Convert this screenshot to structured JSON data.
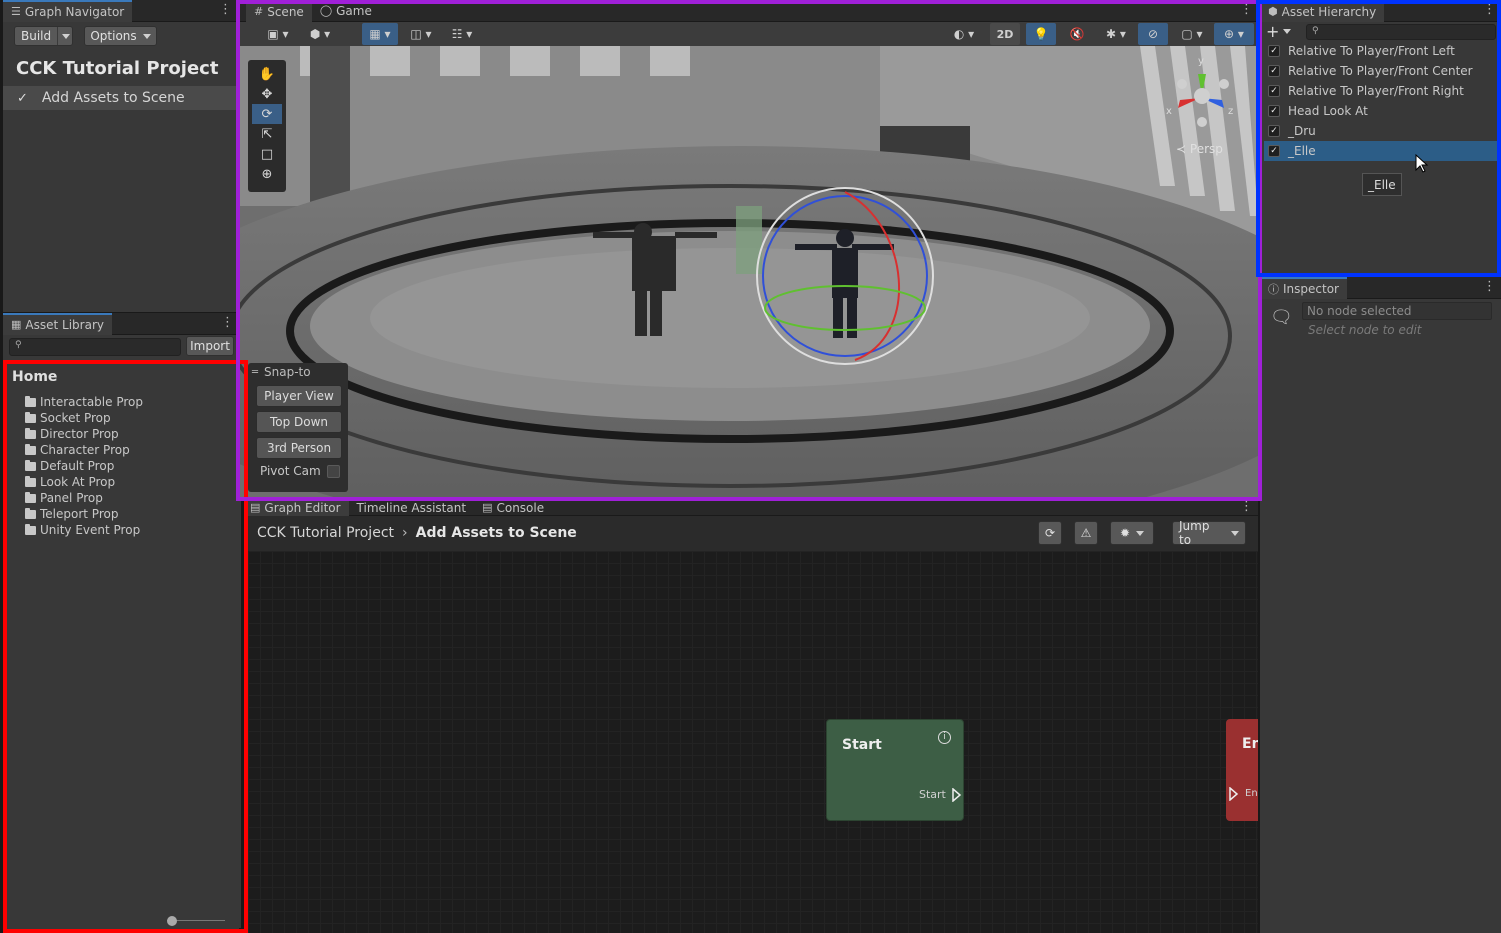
{
  "graph_navigator": {
    "tab_title": "Graph Navigator",
    "build_label": "Build",
    "options_label": "Options",
    "project_title": "CCK Tutorial Project",
    "scene_item": "Add Assets to Scene"
  },
  "asset_library": {
    "tab_title": "Asset Library",
    "import_label": "Import",
    "home_label": "Home",
    "folders": [
      "Interactable Prop",
      "Socket Prop",
      "Director Prop",
      "Character Prop",
      "Default Prop",
      "Look At Prop",
      "Panel Prop",
      "Teleport Prop",
      "Unity Event Prop"
    ]
  },
  "scene_view": {
    "tabs": [
      "Scene",
      "Game"
    ],
    "btn_2d": "2D",
    "persp_label": "Persp",
    "axis_labels": {
      "y": "y",
      "x": "x",
      "z": "z"
    },
    "snap": {
      "title": "Snap-to",
      "player_view": "Player View",
      "top_down": "Top Down",
      "third_person": "3rd Person",
      "pivot_cam": "Pivot Cam"
    }
  },
  "asset_hierarchy": {
    "tab_title": "Asset Hierarchy",
    "items": [
      {
        "label": "Relative To Player/Front Left",
        "checked": true
      },
      {
        "label": "Relative To Player/Front Center",
        "checked": true
      },
      {
        "label": "Relative To Player/Front Right",
        "checked": true
      },
      {
        "label": "Head Look At",
        "checked": true
      },
      {
        "label": "_Dru",
        "checked": true
      },
      {
        "label": "_Elle",
        "checked": true,
        "selected": true
      }
    ],
    "tooltip": "_Elle"
  },
  "inspector": {
    "tab_title": "Inspector",
    "no_node": "No node selected",
    "hint": "Select node to edit"
  },
  "graph_editor": {
    "tabs": [
      "Graph Editor",
      "Timeline Assistant",
      "Console"
    ],
    "breadcrumb_project": "CCK Tutorial Project",
    "breadcrumb_scene": "Add Assets to Scene",
    "jump_label": "Jump to",
    "start_node_title": "Start",
    "start_port_label": "Start",
    "end_node_title": "En",
    "end_port_label": "En"
  },
  "colors": {
    "highlight_red": "#ff0000",
    "highlight_purple": "#a020d8",
    "highlight_blue": "#0033ff",
    "start_node": "#3d5e45",
    "end_node": "#9a3030",
    "selection": "#2c5d87"
  }
}
